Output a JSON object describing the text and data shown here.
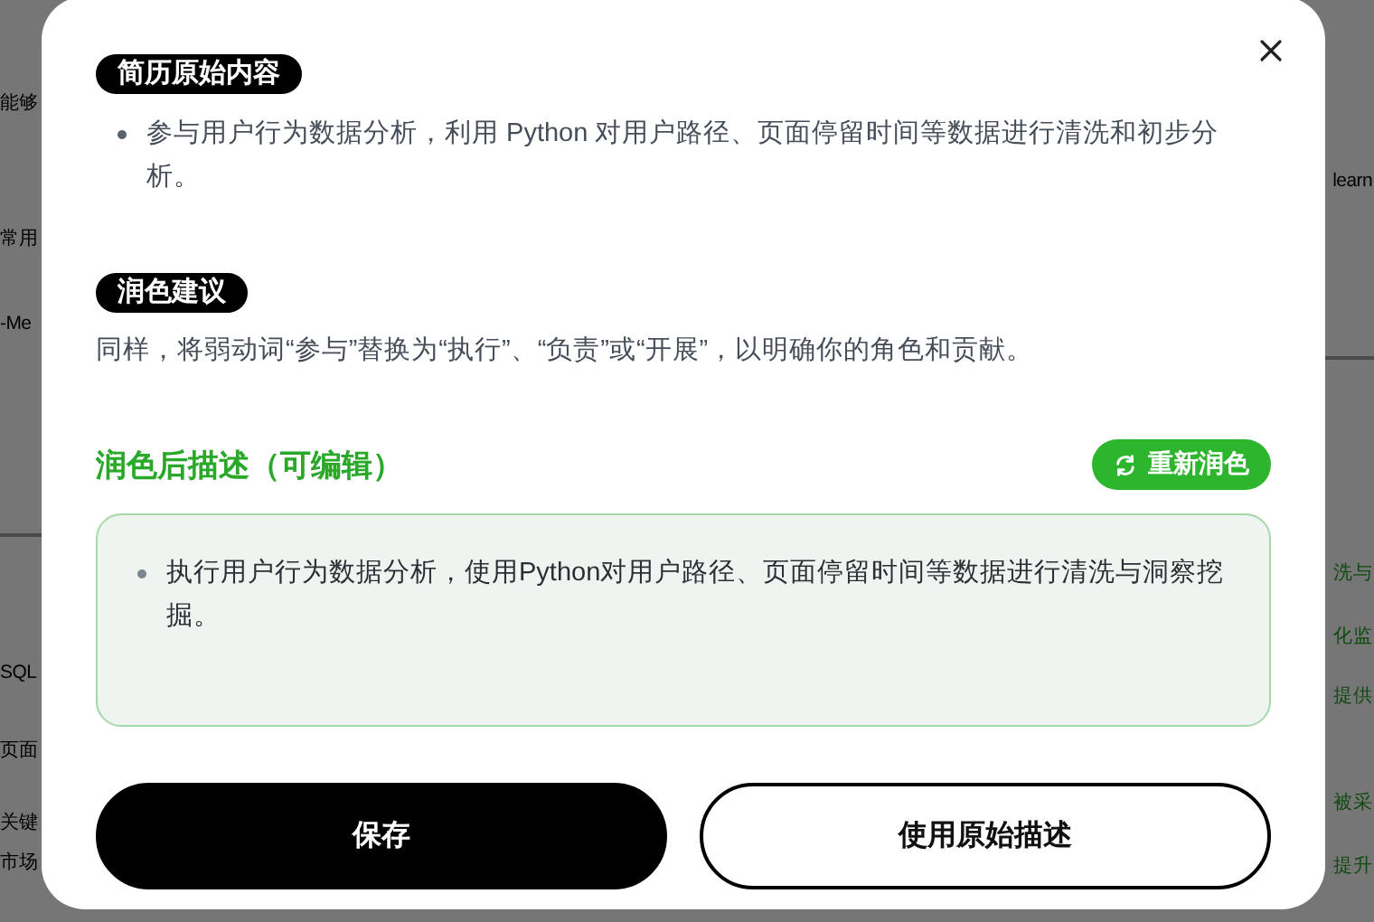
{
  "background": {
    "left_texts": [
      {
        "text": "能够",
        "kind": "plain"
      },
      {
        "text": "常用",
        "kind": "plain"
      },
      {
        "text": "-Me",
        "kind": "plain"
      },
      {
        "text": "SQL",
        "kind": "plain"
      },
      {
        "text": "页面",
        "kind": "plain"
      },
      {
        "text": "关键",
        "kind": "plain"
      },
      {
        "text": "市场",
        "kind": "plain"
      }
    ],
    "right_texts": [
      {
        "text": "learn",
        "kind": "plain"
      },
      {
        "text": "洗与",
        "kind": "accent"
      },
      {
        "text": "化监",
        "kind": "accent"
      },
      {
        "text": "提供",
        "kind": "accent"
      },
      {
        "text": "被采",
        "kind": "accent"
      },
      {
        "text": "提升",
        "kind": "accent"
      }
    ]
  },
  "dialog": {
    "original": {
      "tag": "简历原始内容",
      "bullets": [
        "参与用户行为数据分析，利用 Python 对用户路径、页面停留时间等数据进行清洗和初步分析。"
      ]
    },
    "suggestion": {
      "tag": "润色建议",
      "text": "同样，将弱动词“参与”替换为“执行”、“负责”或“开展”，以明确你的角色和贡献。"
    },
    "polished": {
      "title": "润色后描述（可编辑）",
      "regenerate": "重新润色",
      "bullets": [
        "执行用户行为数据分析，使用Python对用户路径、页面停留时间等数据进行清洗与洞察挖掘。"
      ]
    },
    "buttons": [
      {
        "label": "保存",
        "kind": "primary"
      },
      {
        "label": "使用原始描述",
        "kind": "secondary"
      }
    ]
  }
}
